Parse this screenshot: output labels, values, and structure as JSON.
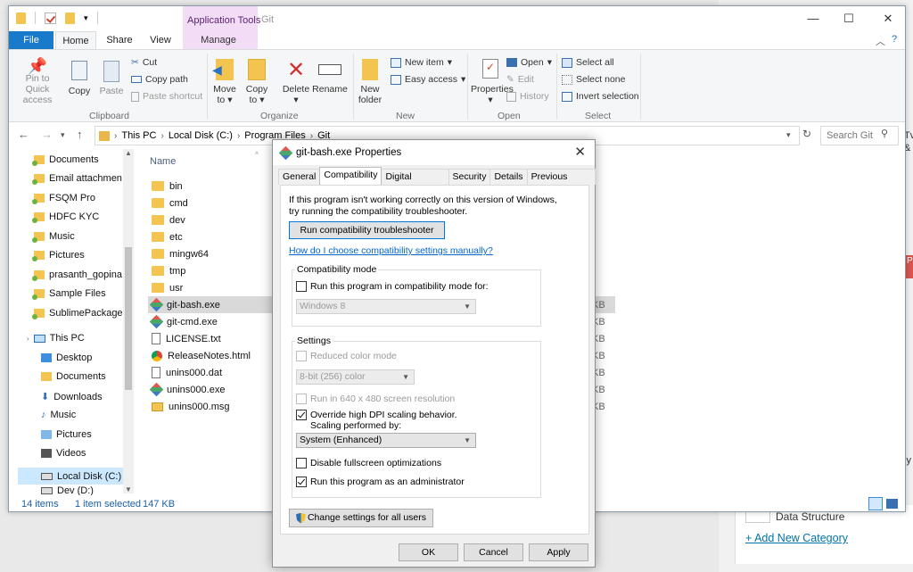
{
  "background": {
    "category_label": "Data Structure",
    "add_category": "+ Add New Category",
    "edge_text_1": "Tv",
    "edge_text_2": "&",
    "edge_text_3": "P",
    "edge_text_4": "ly"
  },
  "explorer": {
    "title": "Git",
    "context_tab": "Application Tools",
    "tabs": {
      "file": "File",
      "home": "Home",
      "share": "Share",
      "view": "View",
      "manage": "Manage"
    },
    "ribbon": {
      "clipboard": {
        "pin": "Pin to Quick access",
        "copy": "Copy",
        "paste": "Paste",
        "cut": "Cut",
        "copy_path": "Copy path",
        "paste_shortcut": "Paste shortcut",
        "label": "Clipboard"
      },
      "organize": {
        "move_to": "Move to",
        "copy_to": "Copy to",
        "delete": "Delete",
        "rename": "Rename",
        "label": "Organize"
      },
      "new": {
        "new_folder": "New folder",
        "new_item": "New item",
        "easy_access": "Easy access",
        "label": "New"
      },
      "open": {
        "properties": "Properties",
        "open": "Open",
        "edit": "Edit",
        "history": "History",
        "label": "Open"
      },
      "select": {
        "select_all": "Select all",
        "select_none": "Select none",
        "invert": "Invert selection",
        "label": "Select"
      }
    },
    "breadcrumb": [
      "This PC",
      "Local Disk (C:)",
      "Program Files",
      "Git"
    ],
    "search_placeholder": "Search Git",
    "nav_items": [
      "Documents",
      "Email attachmen",
      "FSQM Pro",
      "HDFC KYC",
      "Music",
      "Pictures",
      "prasanth_gopina",
      "Sample Files",
      "SublimePackage",
      "This PC",
      "Desktop",
      "Documents",
      "Downloads",
      "Music",
      "Pictures",
      "Videos",
      "Local Disk (C:)",
      "Dev (D:)"
    ],
    "column_name": "Name",
    "files": [
      {
        "name": "bin",
        "type": "folder",
        "size": ""
      },
      {
        "name": "cmd",
        "type": "folder",
        "size": ""
      },
      {
        "name": "dev",
        "type": "folder",
        "size": ""
      },
      {
        "name": "etc",
        "type": "folder",
        "size": ""
      },
      {
        "name": "mingw64",
        "type": "folder",
        "size": ""
      },
      {
        "name": "tmp",
        "type": "folder",
        "size": ""
      },
      {
        "name": "usr",
        "type": "folder",
        "size": ""
      },
      {
        "name": "git-bash.exe",
        "type": "git",
        "size": "KB"
      },
      {
        "name": "git-cmd.exe",
        "type": "git",
        "size": "KB"
      },
      {
        "name": "LICENSE.txt",
        "type": "doc",
        "size": "KB"
      },
      {
        "name": "ReleaseNotes.html",
        "type": "chrome",
        "size": "KB"
      },
      {
        "name": "unins000.dat",
        "type": "doc",
        "size": "KB"
      },
      {
        "name": "unins000.exe",
        "type": "git",
        "size": "KB"
      },
      {
        "name": "unins000.msg",
        "type": "msg",
        "size": "KB"
      }
    ],
    "status": {
      "items": "14 items",
      "selected": "1 item selected",
      "size": "147 KB"
    }
  },
  "dialog": {
    "title": "git-bash.exe Properties",
    "tabs": [
      "General",
      "Compatibility",
      "Digital Signatures",
      "Security",
      "Details",
      "Previous Versions"
    ],
    "intro": "If this program isn't working correctly on this version of Windows, try running the compatibility troubleshooter.",
    "run_troubleshooter": "Run compatibility troubleshooter",
    "manual_link": "How do I choose compatibility settings manually?",
    "compat_mode": {
      "label": "Compatibility mode",
      "checkbox": "Run this program in compatibility mode for:",
      "select": "Windows 8"
    },
    "settings": {
      "label": "Settings",
      "reduced_color": "Reduced color mode",
      "color_select": "8-bit (256) color",
      "run_640": "Run in 640 x 480 screen resolution",
      "override_dpi_1": "Override high DPI scaling behavior.",
      "override_dpi_2": "Scaling performed by:",
      "scaling_select": "System (Enhanced)",
      "disable_fullscreen": "Disable fullscreen optimizations",
      "run_admin": "Run this program as an administrator"
    },
    "change_all_users": "Change settings for all users",
    "ok": "OK",
    "cancel": "Cancel",
    "apply": "Apply"
  }
}
